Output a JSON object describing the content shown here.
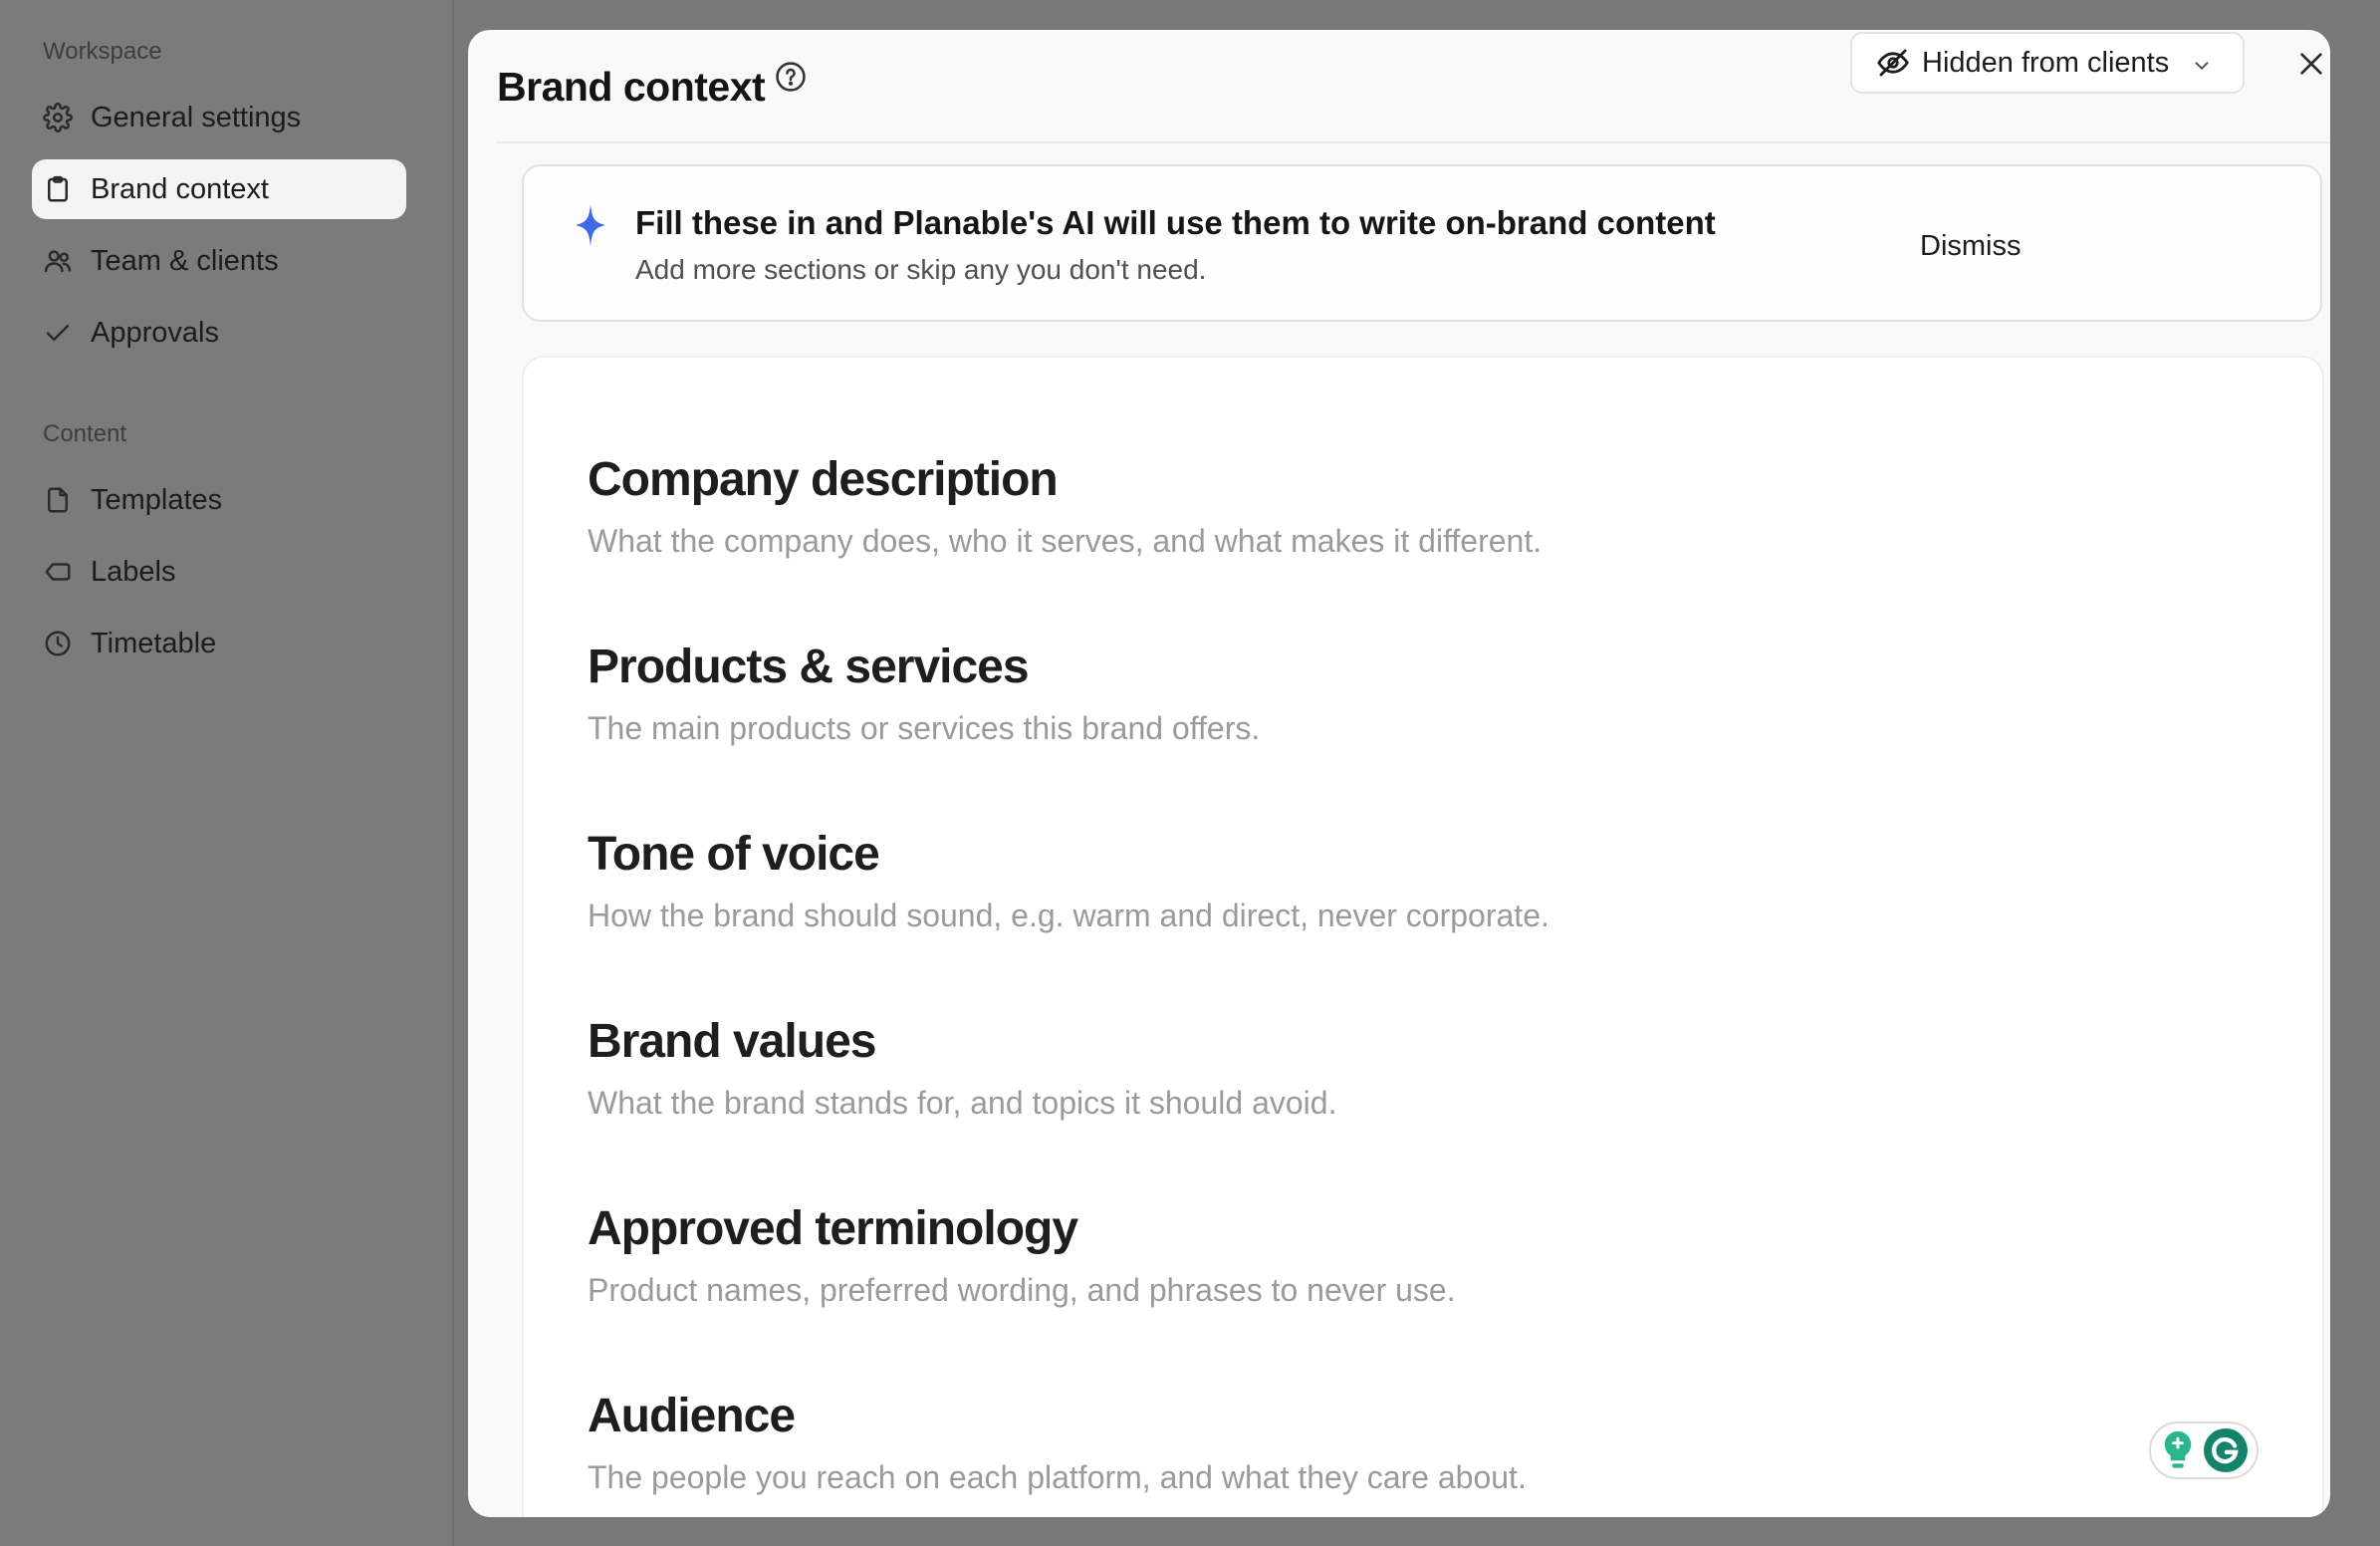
{
  "sidebar": {
    "workspace_label": "Workspace",
    "workspace_items": [
      {
        "label": "General settings",
        "icon": "gear-icon",
        "active": false
      },
      {
        "label": "Brand context",
        "icon": "clipboard-icon",
        "active": true
      },
      {
        "label": "Team & clients",
        "icon": "users-icon",
        "active": false
      },
      {
        "label": "Approvals",
        "icon": "check-icon",
        "active": false
      }
    ],
    "content_label": "Content",
    "content_items": [
      {
        "label": "Templates",
        "icon": "file-icon"
      },
      {
        "label": "Labels",
        "icon": "tag-icon"
      },
      {
        "label": "Timetable",
        "icon": "clock-icon"
      }
    ]
  },
  "modal": {
    "title": "Brand context",
    "help_icon": "question-circle-icon",
    "visibility": {
      "label": "Hidden from clients",
      "icon": "eye-off-icon",
      "dropdown_icon": "chevron-down-icon"
    },
    "close_icon": "close-icon"
  },
  "banner": {
    "icon": "sparkle-icon",
    "title": "Fill these in and Planable's AI will use them to write on-brand content",
    "subtitle": "Add more sections or skip any you don't need.",
    "dismiss_label": "Dismiss"
  },
  "sections": [
    {
      "title": "Company description",
      "placeholder": "What the company does, who it serves, and what makes it different."
    },
    {
      "title": "Products & services",
      "placeholder": "The main products or services this brand offers."
    },
    {
      "title": "Tone of voice",
      "placeholder": "How the brand should sound, e.g. warm and direct, never corporate."
    },
    {
      "title": "Brand values",
      "placeholder": "What the brand stands for, and topics it should avoid."
    },
    {
      "title": "Approved terminology",
      "placeholder": "Product names, preferred wording, and phrases to never use."
    },
    {
      "title": "Audience",
      "placeholder": "The people you reach on each platform, and what they care about."
    }
  ],
  "colors": {
    "accent_sparkle": "#3d6be5",
    "grammarly_green": "#15826b",
    "overlay": "#787878"
  }
}
